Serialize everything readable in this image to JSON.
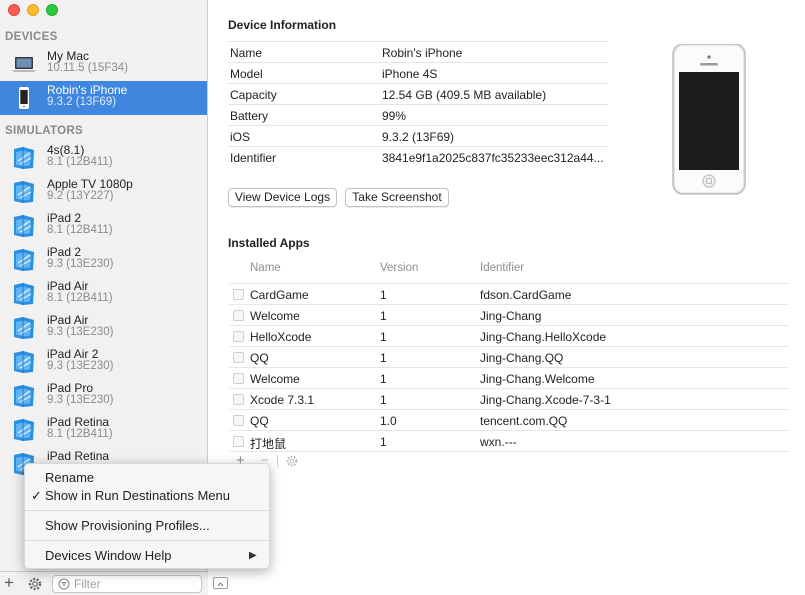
{
  "window": {
    "traffic": [
      "#fc5f57",
      "#fdbc2e",
      "#28c840"
    ]
  },
  "sidebar": {
    "devices_header": "DEVICES",
    "simulators_header": "SIMULATORS",
    "devices": [
      {
        "name": "My Mac",
        "sub": "10.11.5 (15F34)",
        "icon": "laptop-icon"
      },
      {
        "name": "Robin's iPhone",
        "sub": "9.3.2 (13F69)",
        "icon": "iphone-icon",
        "selected": true
      }
    ],
    "simulators": [
      {
        "name": "4s(8.1)",
        "sub": "8.1 (12B411)"
      },
      {
        "name": "Apple TV 1080p",
        "sub": "9.2 (13Y227)"
      },
      {
        "name": "iPad 2",
        "sub": "8.1 (12B411)"
      },
      {
        "name": "iPad 2",
        "sub": "9.3 (13E230)"
      },
      {
        "name": "iPad Air",
        "sub": "8.1 (12B411)"
      },
      {
        "name": "iPad Air",
        "sub": "9.3 (13E230)"
      },
      {
        "name": "iPad Air 2",
        "sub": "9.3 (13E230)"
      },
      {
        "name": "iPad Pro",
        "sub": "9.3 (13E230)"
      },
      {
        "name": "iPad Retina",
        "sub": "8.1 (12B411)"
      },
      {
        "name": "iPad Retina",
        "sub": ""
      }
    ],
    "bottom": {
      "add_label": "+",
      "filter_placeholder": "Filter"
    }
  },
  "context_menu": {
    "rename": "Rename",
    "check": "✓",
    "show_in_run": "Show in Run Destinations Menu",
    "show_profiles": "Show Provisioning Profiles...",
    "help": "Devices Window Help",
    "submenu_arrow": "▶"
  },
  "main": {
    "device_info_title": "Device Information",
    "info": [
      {
        "key": "Name",
        "value": "Robin's iPhone"
      },
      {
        "key": "Model",
        "value": "iPhone 4S"
      },
      {
        "key": "Capacity",
        "value": "12.54 GB (409.5 MB available)"
      },
      {
        "key": "Battery",
        "value": "99%"
      },
      {
        "key": "iOS",
        "value": "9.3.2 (13F69)"
      },
      {
        "key": "Identifier",
        "value": "3841e9f1a2025c837fc35233eec312a44..."
      }
    ],
    "buttons": {
      "view_logs": "View Device Logs",
      "screenshot": "Take Screenshot"
    },
    "installed_title": "Installed Apps",
    "columns": {
      "name": "Name",
      "version": "Version",
      "identifier": "Identifier"
    },
    "apps": [
      {
        "name": "CardGame",
        "version": "1",
        "identifier": "fdson.CardGame"
      },
      {
        "name": "Welcome",
        "version": "1",
        "identifier": "Jing-Chang"
      },
      {
        "name": "HelloXcode",
        "version": "1",
        "identifier": "Jing-Chang.HelloXcode"
      },
      {
        "name": "QQ",
        "version": "1",
        "identifier": "Jing-Chang.QQ"
      },
      {
        "name": "Welcome",
        "version": "1",
        "identifier": "Jing-Chang.Welcome"
      },
      {
        "name": "Xcode 7.3.1",
        "version": "1",
        "identifier": "Jing-Chang.Xcode-7-3-1"
      },
      {
        "name": "QQ",
        "version": "1.0",
        "identifier": "tencent.com.QQ"
      },
      {
        "name": "打地鼠",
        "version": "1",
        "identifier": "wxn.---"
      }
    ],
    "table_controls": {
      "add": "+",
      "remove": "−"
    }
  }
}
